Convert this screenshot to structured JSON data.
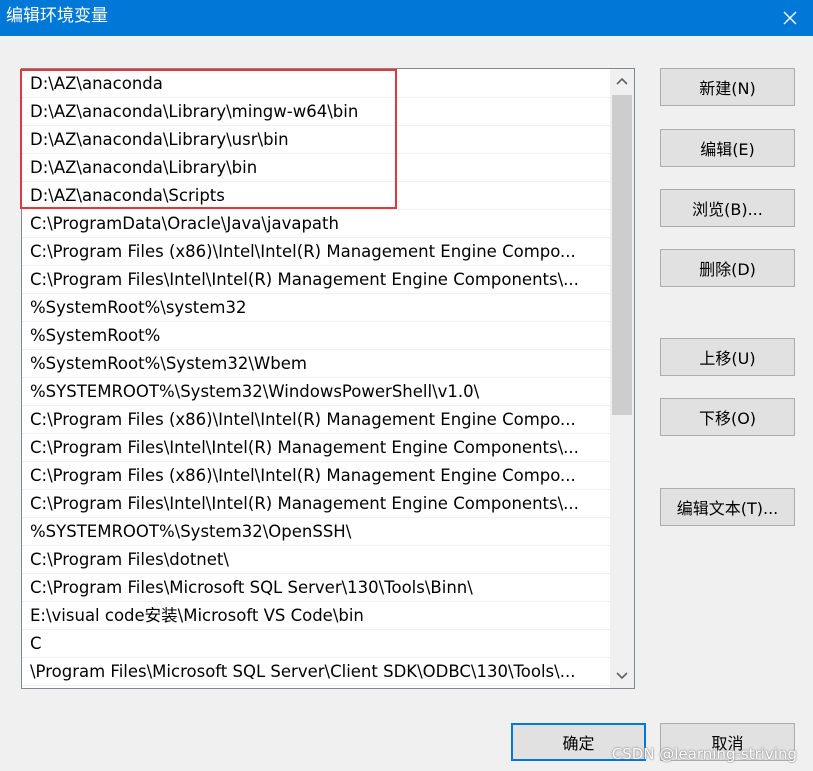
{
  "window": {
    "title": "编辑环境变量"
  },
  "path_entries": [
    "D:\\AZ\\anaconda",
    "D:\\AZ\\anaconda\\Library\\mingw-w64\\bin",
    "D:\\AZ\\anaconda\\Library\\usr\\bin",
    "D:\\AZ\\anaconda\\Library\\bin",
    "D:\\AZ\\anaconda\\Scripts",
    "C:\\ProgramData\\Oracle\\Java\\javapath",
    "C:\\Program Files (x86)\\Intel\\Intel(R) Management Engine Compo...",
    "C:\\Program Files\\Intel\\Intel(R) Management Engine Components\\...",
    "%SystemRoot%\\system32",
    "%SystemRoot%",
    "%SystemRoot%\\System32\\Wbem",
    "%SYSTEMROOT%\\System32\\WindowsPowerShell\\v1.0\\",
    "C:\\Program Files (x86)\\Intel\\Intel(R) Management Engine Compo...",
    "C:\\Program Files\\Intel\\Intel(R) Management Engine Components\\...",
    "C:\\Program Files (x86)\\Intel\\Intel(R) Management Engine Compo...",
    "C:\\Program Files\\Intel\\Intel(R) Management Engine Components\\...",
    "%SYSTEMROOT%\\System32\\OpenSSH\\",
    "C:\\Program Files\\dotnet\\",
    "C:\\Program Files\\Microsoft SQL Server\\130\\Tools\\Binn\\",
    "E:\\visual code安装\\Microsoft VS Code\\bin",
    "C",
    "\\Program Files\\Microsoft SQL Server\\Client SDK\\ODBC\\130\\Tools\\..."
  ],
  "buttons": {
    "new": "新建(N)",
    "edit": "编辑(E)",
    "browse": "浏览(B)...",
    "delete": "删除(D)",
    "move_up": "上移(U)",
    "move_down": "下移(O)",
    "edit_text": "编辑文本(T)...",
    "ok": "确定",
    "cancel": "取消"
  },
  "watermark": "CSDN @learning-striving",
  "colors": {
    "titlebar": "#0078d7",
    "highlight_box": "#e0383e"
  },
  "icons": {
    "close": "close-icon",
    "scroll_up": "chevron-up-icon",
    "scroll_down": "chevron-down-icon"
  }
}
